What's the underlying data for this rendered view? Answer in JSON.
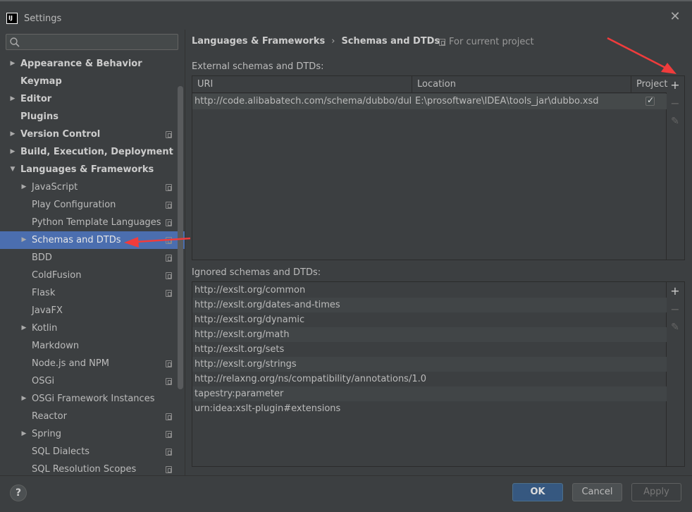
{
  "window": {
    "title": "Settings",
    "logo_text": "IJ"
  },
  "search": {
    "placeholder": "Q▾",
    "value": ""
  },
  "sidebar": {
    "items": [
      {
        "label": "Appearance & Behavior",
        "bold": true,
        "arrow": "right",
        "indent": 0,
        "proj": false
      },
      {
        "label": "Keymap",
        "bold": true,
        "arrow": "",
        "indent": 0,
        "proj": false
      },
      {
        "label": "Editor",
        "bold": true,
        "arrow": "right",
        "indent": 0,
        "proj": false
      },
      {
        "label": "Plugins",
        "bold": true,
        "arrow": "",
        "indent": 0,
        "proj": false
      },
      {
        "label": "Version Control",
        "bold": true,
        "arrow": "right",
        "indent": 0,
        "proj": true
      },
      {
        "label": "Build, Execution, Deployment",
        "bold": true,
        "arrow": "right",
        "indent": 0,
        "proj": false
      },
      {
        "label": "Languages & Frameworks",
        "bold": true,
        "arrow": "down",
        "indent": 0,
        "proj": false
      },
      {
        "label": "JavaScript",
        "bold": false,
        "arrow": "right",
        "indent": 1,
        "proj": true
      },
      {
        "label": "Play Configuration",
        "bold": false,
        "arrow": "",
        "indent": 1,
        "proj": true
      },
      {
        "label": "Python Template Languages",
        "bold": false,
        "arrow": "",
        "indent": 1,
        "proj": true
      },
      {
        "label": "Schemas and DTDs",
        "bold": false,
        "arrow": "right",
        "indent": 1,
        "proj": true,
        "selected": true
      },
      {
        "label": "BDD",
        "bold": false,
        "arrow": "",
        "indent": 1,
        "proj": true
      },
      {
        "label": "ColdFusion",
        "bold": false,
        "arrow": "",
        "indent": 1,
        "proj": true
      },
      {
        "label": "Flask",
        "bold": false,
        "arrow": "",
        "indent": 1,
        "proj": true
      },
      {
        "label": "JavaFX",
        "bold": false,
        "arrow": "",
        "indent": 1,
        "proj": false
      },
      {
        "label": "Kotlin",
        "bold": false,
        "arrow": "right",
        "indent": 1,
        "proj": false
      },
      {
        "label": "Markdown",
        "bold": false,
        "arrow": "",
        "indent": 1,
        "proj": false
      },
      {
        "label": "Node.js and NPM",
        "bold": false,
        "arrow": "",
        "indent": 1,
        "proj": true
      },
      {
        "label": "OSGi",
        "bold": false,
        "arrow": "",
        "indent": 1,
        "proj": true
      },
      {
        "label": "OSGi Framework Instances",
        "bold": false,
        "arrow": "right",
        "indent": 1,
        "proj": false
      },
      {
        "label": "Reactor",
        "bold": false,
        "arrow": "",
        "indent": 1,
        "proj": true
      },
      {
        "label": "Spring",
        "bold": false,
        "arrow": "right",
        "indent": 1,
        "proj": true
      },
      {
        "label": "SQL Dialects",
        "bold": false,
        "arrow": "",
        "indent": 1,
        "proj": true
      },
      {
        "label": "SQL Resolution Scopes",
        "bold": false,
        "arrow": "",
        "indent": 1,
        "proj": true
      }
    ]
  },
  "breadcrumb": {
    "parent": "Languages & Frameworks",
    "separator": "›",
    "current": "Schemas and DTDs"
  },
  "scope": {
    "label": "For current project"
  },
  "external": {
    "label": "External schemas and DTDs:",
    "columns": {
      "uri": "URI",
      "location": "Location",
      "project": "Project"
    },
    "rows": [
      {
        "uri": "http://code.alibabatech.com/schema/dubbo/dubb...",
        "location": "E:\\prosoftware\\IDEA\\tools_jar\\dubbo.xsd",
        "project": true
      }
    ]
  },
  "ignored": {
    "label": "Ignored schemas and DTDs:",
    "rows": [
      "http://exslt.org/common",
      "http://exslt.org/dates-and-times",
      "http://exslt.org/dynamic",
      "http://exslt.org/math",
      "http://exslt.org/sets",
      "http://exslt.org/strings",
      "http://relaxng.org/ns/compatibility/annotations/1.0",
      "tapestry:parameter",
      "urn:idea:xslt-plugin#extensions"
    ]
  },
  "toolbar": {
    "add": "+",
    "remove": "−",
    "edit": "✎"
  },
  "footer": {
    "help": "?",
    "ok": "OK",
    "cancel": "Cancel",
    "apply": "Apply"
  },
  "colors": {
    "accent": "#4b6eaf",
    "annotation_arrow": "#f03c3c",
    "ok_button": "#365880"
  }
}
